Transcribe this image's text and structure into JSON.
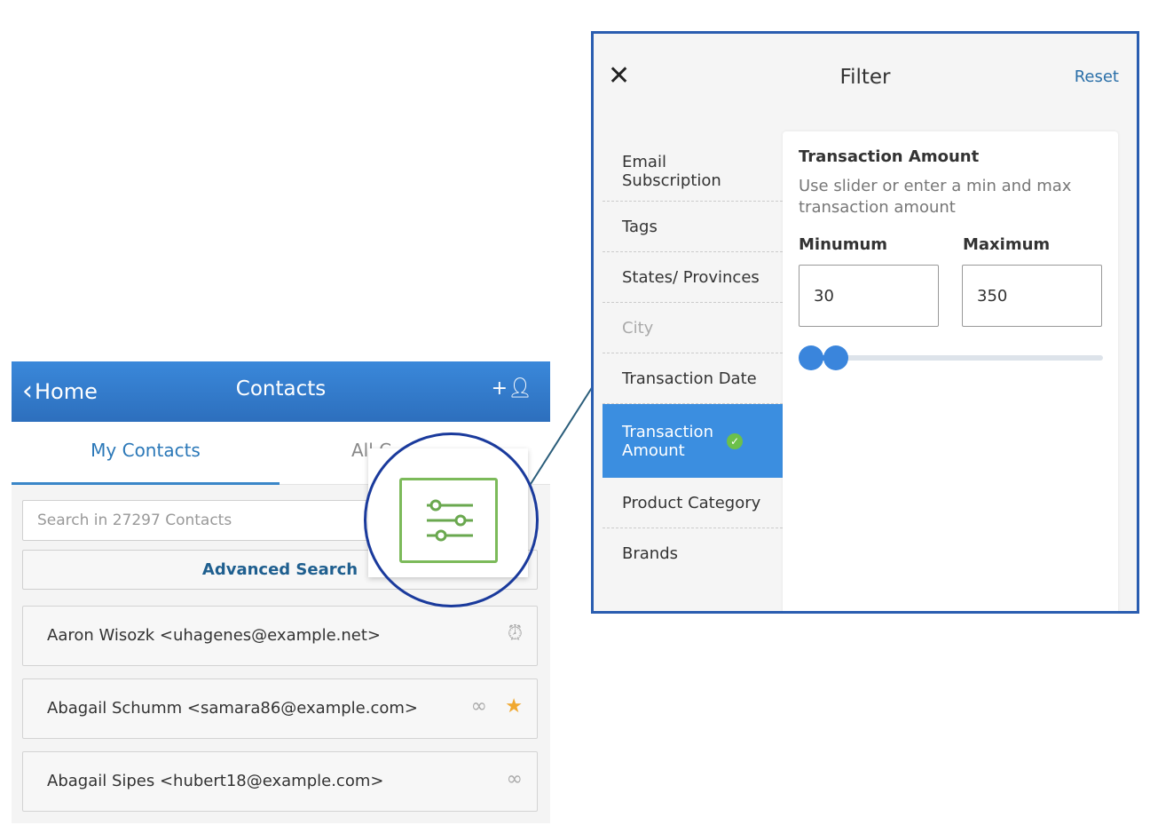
{
  "contacts": {
    "header": {
      "back_label": "Home",
      "title": "Contacts",
      "add_icon": "add-user-icon"
    },
    "tabs": [
      {
        "label": "My Contacts",
        "active": true
      },
      {
        "label": "All C"
      }
    ],
    "search": {
      "placeholder": "Search in 27297 Contacts"
    },
    "advanced_search_label": "Advanced Search",
    "filter_icon": "sliders-icon",
    "rows": [
      {
        "text": "Aaron Wisozk <uhagenes@example.net>",
        "icons": [
          "alarm-icon"
        ]
      },
      {
        "text": "Abagail Schumm <samara86@example.com>",
        "icons": [
          "link-icon",
          "star-icon"
        ]
      },
      {
        "text": "Abagail Sipes <hubert18@example.com>",
        "icons": [
          "link-icon"
        ]
      }
    ]
  },
  "filter": {
    "title": "Filter",
    "reset_label": "Reset",
    "close_icon": "close-icon",
    "items": [
      {
        "label": "Email Subscription"
      },
      {
        "label": "Tags"
      },
      {
        "label": "States/ Provinces"
      },
      {
        "label": "City",
        "disabled": true
      },
      {
        "label": "Transaction Date"
      },
      {
        "label": "Transaction Amount",
        "selected": true
      },
      {
        "label": "Product Category"
      },
      {
        "label": "Brands"
      }
    ],
    "content": {
      "heading": "Transaction Amount",
      "description": "Use slider or enter a min and max transaction amount",
      "min_label": "Minumum",
      "max_label": "Maximum",
      "min_value": "30",
      "max_value": "350"
    }
  },
  "colors": {
    "accent": "#3a86d8",
    "highlight": "#1a3a9c",
    "star": "#f0a830",
    "check": "#6cc04a"
  }
}
